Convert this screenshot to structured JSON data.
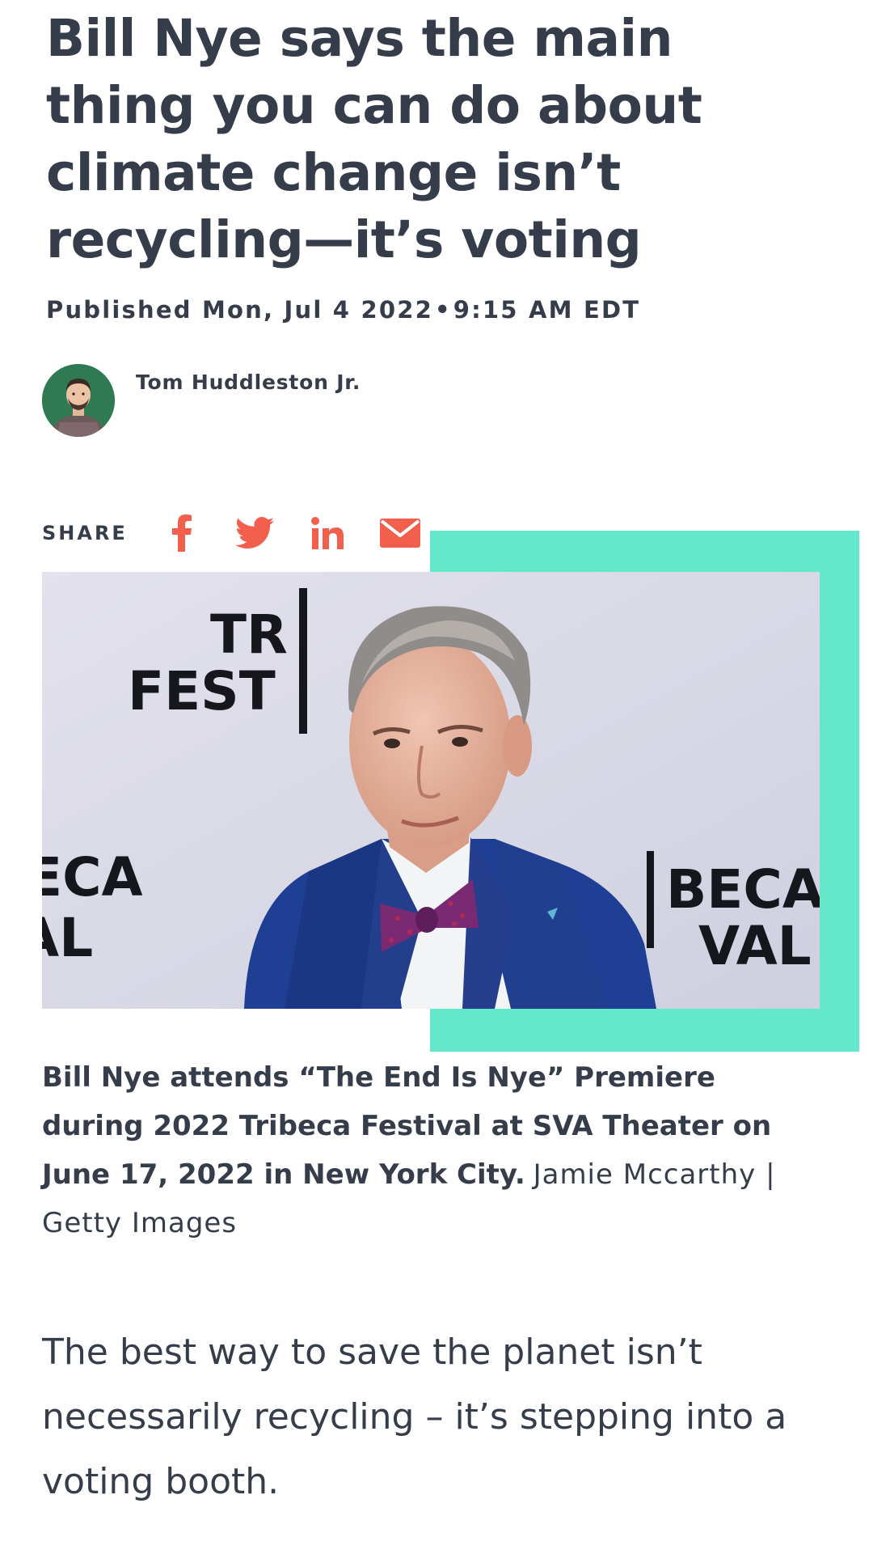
{
  "article": {
    "headline": "Bill Nye says the main thing you can do about climate change isn’t recycling—it’s voting",
    "published_label": "Published",
    "published_date": "Mon, Jul 4 2022",
    "separator": "•",
    "published_time": "9:15 AM EDT",
    "author": "Tom Huddleston Jr.",
    "body_intro": "The best way to save the planet isn’t necessarily recycling – it’s stepping into a voting booth."
  },
  "share": {
    "label": "SHARE",
    "icons": [
      "facebook-icon",
      "twitter-icon",
      "linkedin-icon",
      "email-icon"
    ],
    "icon_color": "#f25f4c"
  },
  "photo": {
    "backdrop_text_left_top": [
      "TR",
      "FEST"
    ],
    "backdrop_text_left_bottom": [
      "ECA",
      "AL"
    ],
    "backdrop_text_right_bottom": [
      "BECA",
      "VAL"
    ],
    "accent_color": "#64e8c9"
  },
  "caption": {
    "description": "Bill Nye attends “The End Is Nye” Premiere during 2022 Tribeca Festival at SVA Theater on June 17, 2022 in New York City.",
    "credit": "Jamie Mccarthy | Getty Images"
  }
}
